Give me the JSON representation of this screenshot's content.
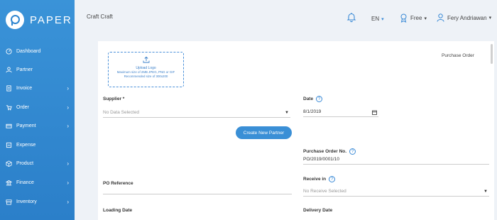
{
  "app": {
    "brand": "PAPER"
  },
  "sidebar": {
    "items": [
      {
        "label": "Dashboard",
        "icon": "dashboard-icon",
        "chevron": false
      },
      {
        "label": "Partner",
        "icon": "user-icon",
        "chevron": false
      },
      {
        "label": "Invoice",
        "icon": "invoice-icon",
        "chevron": true
      },
      {
        "label": "Order",
        "icon": "cart-icon",
        "chevron": true
      },
      {
        "label": "Payment",
        "icon": "card-icon",
        "chevron": true
      },
      {
        "label": "Expense",
        "icon": "expense-icon",
        "chevron": false
      },
      {
        "label": "Product",
        "icon": "box-icon",
        "chevron": true
      },
      {
        "label": "Finance",
        "icon": "bank-icon",
        "chevron": true
      },
      {
        "label": "Inventory",
        "icon": "inventory-icon",
        "chevron": true
      }
    ],
    "chevron_glyph": "›"
  },
  "header": {
    "breadcrumb": "Craft Craft",
    "language": "EN",
    "plan": "Free",
    "user": "Fery Andriawan",
    "caret": "▾"
  },
  "form": {
    "document_type": "Purchase Order",
    "upload": {
      "title": "Upload Logo",
      "line1": "Maximum size of 2MB JPEG, PNG or GIF",
      "line2": "Recommended size of 300x200"
    },
    "supplier": {
      "label": "Supplier *",
      "placeholder": "No Data Selected"
    },
    "create_partner": "Create New Partner",
    "date": {
      "label": "Date",
      "value": "8/1/2019"
    },
    "po_number": {
      "label": "Purchase Order No.",
      "value": "PO/2019/0001/10"
    },
    "po_reference": {
      "label": "PO Reference",
      "value": ""
    },
    "receive_in": {
      "label": "Receive in",
      "placeholder": "No Receive Selected"
    },
    "loading_date": {
      "label": "Loading Date"
    },
    "delivery_date": {
      "label": "Delivery Date"
    },
    "help_glyph": "?",
    "dropdown_glyph": "▼"
  },
  "colors": {
    "sidebar": "#2f86d0",
    "accent": "#3a8fd6",
    "background": "#eef2f7"
  }
}
